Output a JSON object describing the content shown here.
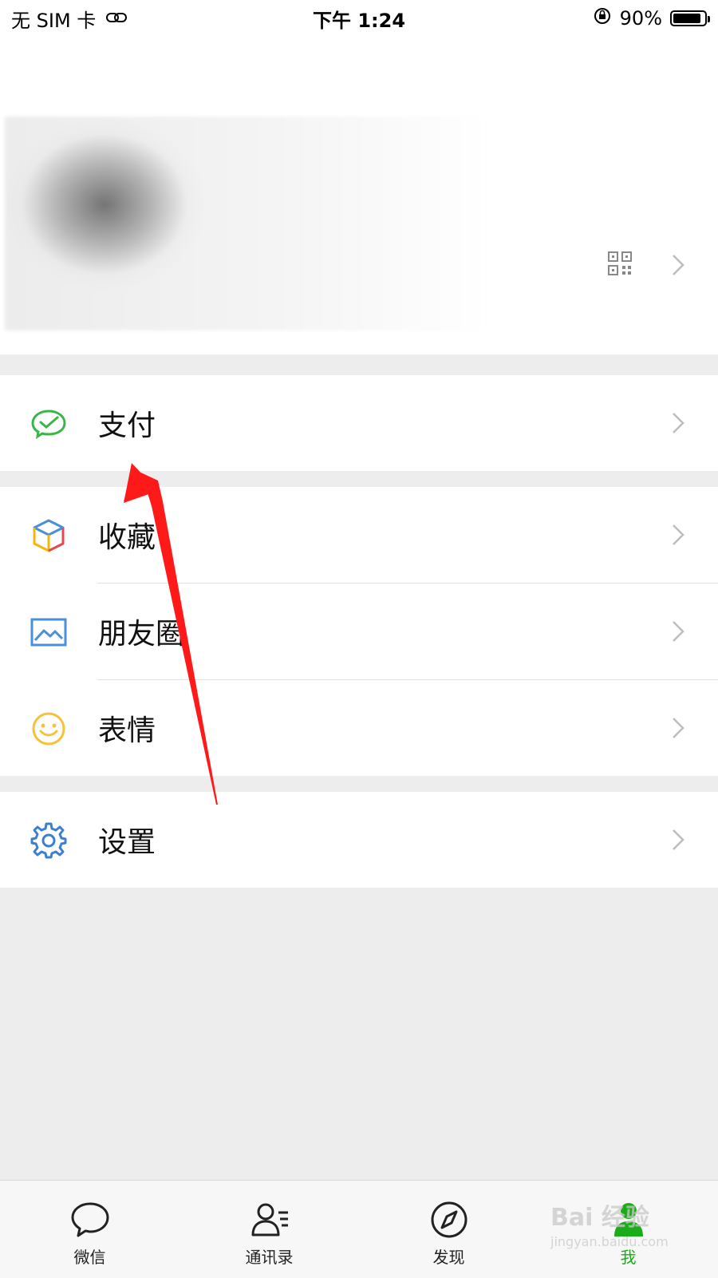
{
  "status_bar": {
    "carrier": "无 SIM 卡",
    "time": "下午 1:24",
    "battery_percent": "90%",
    "battery_level": 0.9
  },
  "profile": {},
  "menu": {
    "pay": {
      "label": "支付"
    },
    "favorites": {
      "label": "收藏"
    },
    "moments": {
      "label": "朋友圈"
    },
    "stickers": {
      "label": "表情"
    },
    "settings": {
      "label": "设置"
    }
  },
  "tabbar": {
    "items": [
      {
        "label": "微信",
        "icon": "chat-bubble-icon"
      },
      {
        "label": "通讯录",
        "icon": "contacts-icon"
      },
      {
        "label": "发现",
        "icon": "compass-icon"
      },
      {
        "label": "我",
        "icon": "person-icon",
        "active": true
      }
    ]
  },
  "watermark": {
    "text": "Bai 经验",
    "sub": "jingyan.baidu.com"
  },
  "colors": {
    "accent_green": "#1aad19",
    "annotation_arrow": "#ff1a1a"
  }
}
